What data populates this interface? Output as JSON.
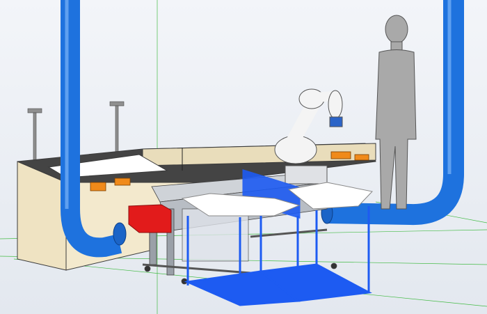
{
  "viewport": {
    "background": "#eef1f6",
    "grid_color": "#1faa1f"
  },
  "scene": {
    "objects": [
      {
        "id": "left-duct",
        "kind": "ventilation-duct",
        "color": "#1e72de"
      },
      {
        "id": "right-duct",
        "kind": "ventilation-duct",
        "color": "#1e72de"
      },
      {
        "id": "workbench",
        "kind": "enclosure",
        "color": "#f0e6c8"
      },
      {
        "id": "robot-arm",
        "kind": "collaborative-robot",
        "color": "#f2f2f2"
      },
      {
        "id": "mannequin",
        "kind": "human-model",
        "color": "#a9a9a9"
      },
      {
        "id": "conveyor",
        "kind": "conveyor-frame",
        "color": "#c9cdd3"
      },
      {
        "id": "red-box",
        "kind": "component",
        "color": "#e21b1b"
      },
      {
        "id": "blue-cells",
        "kind": "wireframe-cells",
        "color": "#1d5bf2"
      },
      {
        "id": "gripper-trays",
        "kind": "fixtures",
        "color": "#f08a1a"
      },
      {
        "id": "light-posts",
        "kind": "signal-posts",
        "color": "#8c8c8c"
      }
    ]
  }
}
